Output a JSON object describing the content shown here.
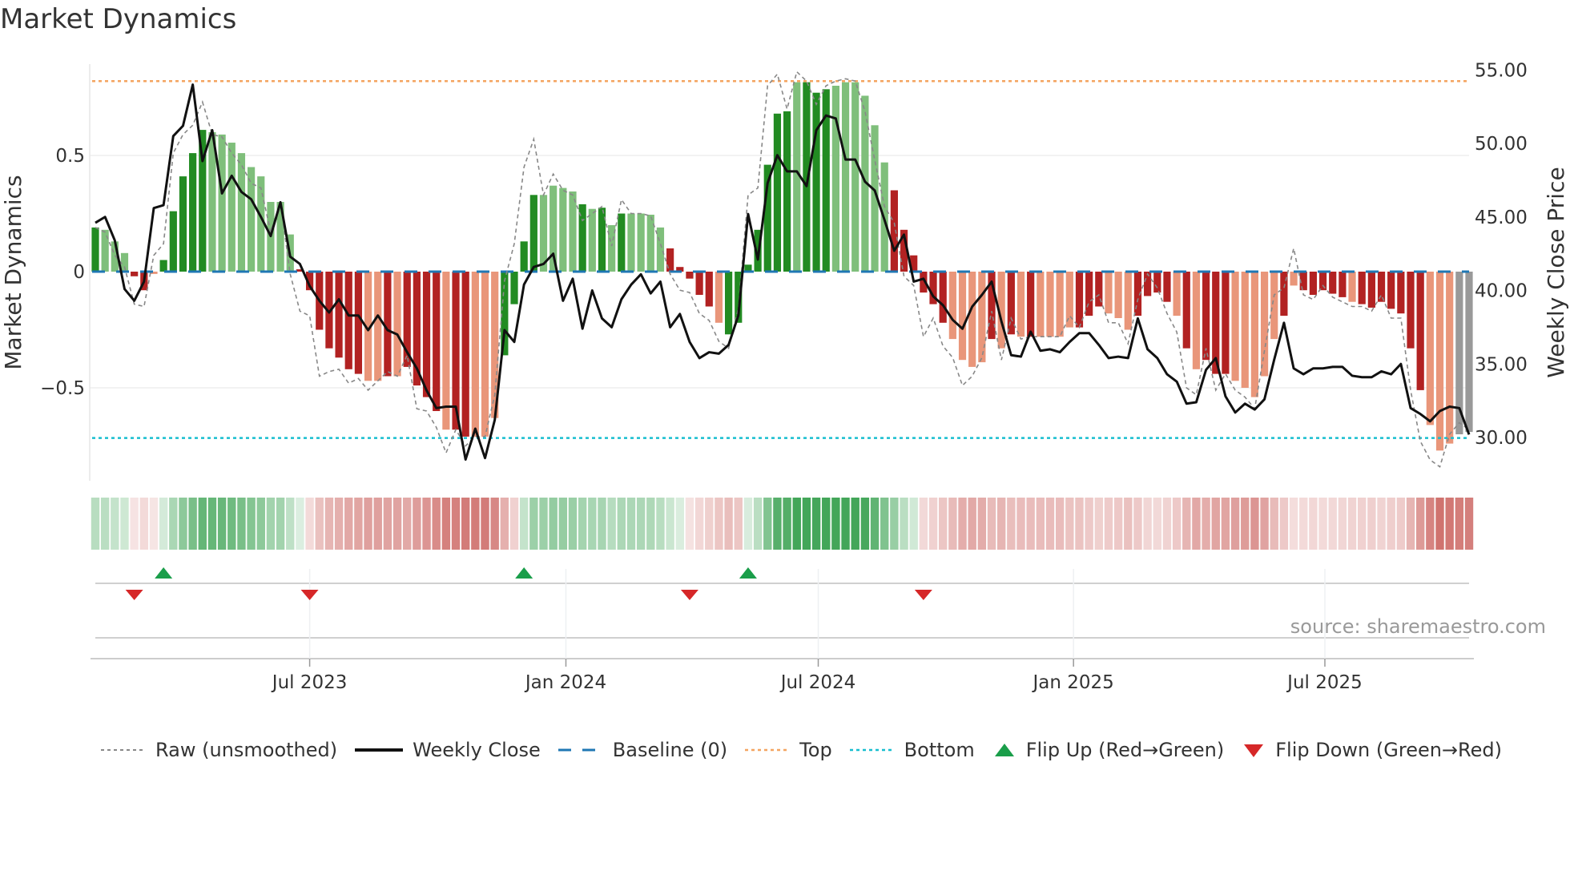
{
  "title": "Market Dynamics",
  "source": "source: sharemaestro.com",
  "colors": {
    "rising_positive": "#228b22",
    "falling_positive": "#7fbf7b",
    "falling_negative": "#b22222",
    "rising_negative": "#e9967a",
    "top": "#f4a460",
    "bottom": "#17becf",
    "baseline": "#1f77b4",
    "flip_up": "#1a9e4a",
    "flip_down": "#d62728"
  },
  "chart_data": {
    "type": "bar",
    "title": "Market Dynamics",
    "ylabel": "Market Dynamics",
    "y2label": "Weekly Close Price",
    "ylim": [
      -0.9,
      0.92
    ],
    "y2lim": [
      28.2,
      56.1
    ],
    "yticks": [
      "0.5",
      "0",
      "−0.5"
    ],
    "ytick_values": [
      0.5,
      0,
      -0.5
    ],
    "y2ticks": [
      "55.00",
      "50.00",
      "45.00",
      "40.00",
      "35.00",
      "30.00"
    ],
    "y2tick_values": [
      55,
      50,
      45,
      40,
      35,
      30
    ],
    "xticks": [
      "Jul 2023",
      "Jan 2024",
      "Jul 2024",
      "Jan 2025",
      "Jul 2025"
    ],
    "xtick_index": [
      22,
      48.3,
      74.2,
      100.4,
      126.2
    ],
    "frequency": "weekly",
    "top_level": 0.82,
    "bottom_level": -0.716,
    "baseline": 0,
    "dynamics": [
      0.19,
      0.18,
      0.13,
      0.08,
      -0.02,
      -0.08,
      -0.01,
      0.05,
      0.26,
      0.41,
      0.51,
      0.61,
      0.6,
      0.59,
      0.555,
      0.51,
      0.45,
      0.41,
      0.3,
      0.3,
      0.16,
      0.01,
      -0.08,
      -0.25,
      -0.33,
      -0.37,
      -0.42,
      -0.44,
      -0.47,
      -0.47,
      -0.45,
      -0.45,
      -0.41,
      -0.49,
      -0.54,
      -0.6,
      -0.68,
      -0.68,
      -0.71,
      -0.71,
      -0.71,
      -0.63,
      -0.36,
      -0.14,
      0.13,
      0.33,
      0.33,
      0.37,
      0.36,
      0.345,
      0.29,
      0.27,
      0.275,
      0.2,
      0.25,
      0.25,
      0.25,
      0.245,
      0.19,
      0.1,
      0.02,
      -0.03,
      -0.1,
      -0.15,
      -0.22,
      -0.27,
      -0.22,
      0.03,
      0.18,
      0.46,
      0.68,
      0.69,
      0.815,
      0.815,
      0.77,
      0.785,
      0.8,
      0.815,
      0.815,
      0.757,
      0.63,
      0.47,
      0.35,
      0.18,
      0.07,
      -0.09,
      -0.14,
      -0.22,
      -0.29,
      -0.38,
      -0.41,
      -0.39,
      -0.29,
      -0.33,
      -0.27,
      -0.28,
      -0.28,
      -0.28,
      -0.28,
      -0.28,
      -0.24,
      -0.24,
      -0.19,
      -0.15,
      -0.18,
      -0.2,
      -0.25,
      -0.19,
      -0.105,
      -0.09,
      -0.13,
      -0.19,
      -0.33,
      -0.42,
      -0.38,
      -0.44,
      -0.44,
      -0.47,
      -0.5,
      -0.54,
      -0.45,
      -0.29,
      -0.19,
      -0.06,
      -0.08,
      -0.1,
      -0.08,
      -0.095,
      -0.11,
      -0.13,
      -0.14,
      -0.155,
      -0.13,
      -0.16,
      -0.18,
      -0.33,
      -0.51,
      -0.66,
      -0.77,
      -0.74,
      -0.7,
      -0.69
    ],
    "bar_state": "GgggRRrGGGGGgggggggggRRRRRRRrrRrRRRRrRRrrrGGGGggggGgGgGggggRRRRRrGGGGGGGgGGGggggggRRRRRRrrrrRrRrRrrrrRRRrrrRRRRrRrRRRrrrrrRrRRRRRrRRRRRRRrrr",
    "raw": [
      0.19,
      0.17,
      0.07,
      0.02,
      -0.14,
      -0.15,
      0.07,
      0.12,
      0.51,
      0.59,
      0.63,
      0.73,
      0.59,
      0.58,
      0.51,
      0.46,
      0.38,
      0.36,
      0.17,
      0.3,
      -0.01,
      -0.17,
      -0.19,
      -0.45,
      -0.43,
      -0.42,
      -0.48,
      -0.46,
      -0.51,
      -0.47,
      -0.43,
      -0.45,
      -0.36,
      -0.59,
      -0.6,
      -0.67,
      -0.78,
      -0.68,
      -0.75,
      -0.71,
      -0.71,
      -0.53,
      -0.04,
      0.12,
      0.45,
      0.57,
      0.33,
      0.42,
      0.35,
      0.33,
      0.22,
      0.25,
      0.28,
      0.11,
      0.31,
      0.25,
      0.25,
      0.24,
      0.12,
      -0.01,
      -0.08,
      -0.09,
      -0.18,
      -0.21,
      -0.3,
      -0.33,
      -0.16,
      0.33,
      0.36,
      0.8,
      0.85,
      0.7,
      0.86,
      0.82,
      0.72,
      0.8,
      0.82,
      0.83,
      0.82,
      0.69,
      0.48,
      0.28,
      0.21,
      -0.02,
      -0.06,
      -0.28,
      -0.2,
      -0.32,
      -0.37,
      -0.49,
      -0.45,
      -0.37,
      -0.17,
      -0.38,
      -0.2,
      -0.29,
      -0.28,
      -0.28,
      -0.28,
      -0.28,
      -0.19,
      -0.24,
      -0.13,
      -0.1,
      -0.22,
      -0.22,
      -0.31,
      -0.12,
      -0.01,
      -0.07,
      -0.18,
      -0.26,
      -0.5,
      -0.53,
      -0.33,
      -0.51,
      -0.44,
      -0.51,
      -0.54,
      -0.59,
      -0.34,
      -0.1,
      -0.07,
      0.1,
      -0.1,
      -0.12,
      -0.06,
      -0.11,
      -0.13,
      -0.15,
      -0.15,
      -0.17,
      -0.1,
      -0.2,
      -0.2,
      -0.51,
      -0.73,
      -0.81,
      -0.84,
      -0.7,
      -0.65,
      -0.68
    ],
    "weekly_close": [
      44.6,
      45.0,
      43.4,
      40.1,
      39.3,
      40.6,
      45.6,
      45.8,
      50.5,
      51.2,
      54.0,
      48.8,
      50.9,
      46.6,
      47.8,
      46.7,
      46.2,
      45.0,
      43.7,
      46.0,
      42.3,
      41.8,
      40.3,
      39.3,
      38.5,
      39.4,
      38.3,
      38.3,
      37.3,
      38.3,
      37.3,
      37.0,
      35.8,
      34.7,
      33.2,
      32.0,
      32.1,
      32.1,
      28.5,
      30.6,
      28.6,
      31.2,
      37.3,
      36.5,
      40.4,
      41.6,
      41.8,
      42.5,
      39.3,
      40.8,
      37.4,
      40.0,
      38.1,
      37.5,
      39.4,
      40.4,
      41.1,
      39.8,
      40.6,
      37.5,
      38.4,
      36.5,
      35.4,
      35.8,
      35.7,
      36.3,
      38.3,
      45.2,
      42.1,
      47.3,
      49.2,
      48.1,
      48.1,
      47.1,
      50.9,
      51.9,
      51.7,
      48.9,
      48.9,
      47.4,
      46.8,
      44.8,
      42.7,
      43.8,
      40.6,
      40.8,
      39.6,
      39.0,
      38.0,
      37.4,
      38.9,
      39.7,
      40.6,
      37.9,
      35.6,
      35.5,
      37.2,
      35.9,
      36.0,
      35.8,
      36.5,
      37.1,
      37.1,
      36.3,
      35.4,
      35.5,
      35.4,
      38.1,
      36.0,
      35.4,
      34.3,
      33.8,
      32.3,
      32.4,
      34.6,
      35.4,
      32.8,
      31.7,
      32.3,
      31.9,
      32.6,
      35.3,
      37.8,
      34.7,
      34.3,
      34.7,
      34.7,
      34.8,
      34.8,
      34.2,
      34.1,
      34.1,
      34.5,
      34.3,
      35.0,
      32.0,
      31.6,
      31.1,
      31.8,
      32.1,
      32.0,
      30.2
    ],
    "flips": [
      {
        "index": 4,
        "type": "down"
      },
      {
        "index": 7,
        "type": "up"
      },
      {
        "index": 22,
        "type": "down"
      },
      {
        "index": 44,
        "type": "up"
      },
      {
        "index": 61,
        "type": "down"
      },
      {
        "index": 67,
        "type": "up"
      },
      {
        "index": 85,
        "type": "down"
      }
    ],
    "legend": {
      "placement": "bottom",
      "entries": [
        "Raw (unsmoothed)",
        "Weekly Close",
        "Baseline (0)",
        "Top",
        "Bottom",
        "Flip Up (Red→Green)",
        "Flip Down (Green→Red)"
      ]
    }
  }
}
